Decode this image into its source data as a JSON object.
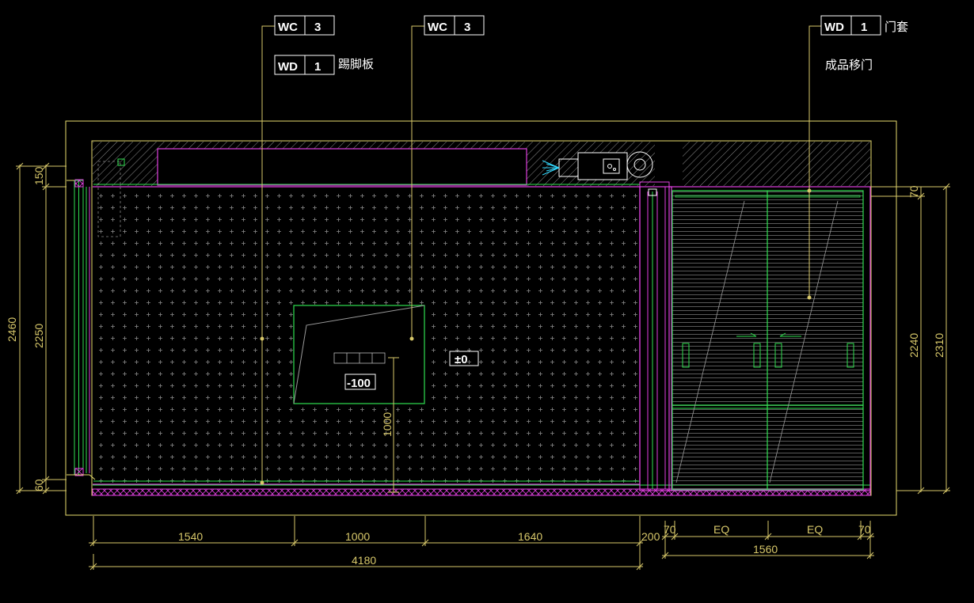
{
  "drawing": {
    "colors": {
      "background": "#000000",
      "outline": "#e8dc6e",
      "dimension": "#d8c86a",
      "magenta": "#e040e0",
      "green": "#30e050",
      "grey": "#9a9a9a",
      "cyan": "#30d8ff",
      "white": "#ffffff"
    },
    "tags": [
      {
        "code": "WC",
        "num": "3",
        "note": ""
      },
      {
        "code": "WD",
        "num": "1",
        "note": "踢脚板"
      },
      {
        "code": "WC",
        "num": "3",
        "note": ""
      },
      {
        "code": "WD",
        "num": "1",
        "note": "门套"
      }
    ],
    "notes": {
      "door": "成品移门"
    },
    "levels": {
      "floor": "±0",
      "recess": "-100"
    },
    "bottom_dims": {
      "row1": [
        "1540",
        "1000",
        "1640",
        "200",
        "70",
        "EQ",
        "EQ",
        "70"
      ],
      "row2": [
        "4180",
        "1560"
      ]
    },
    "left_dims": [
      "2460",
      "2250",
      "150",
      "60"
    ],
    "right_dims": [
      "2240",
      "2310",
      "70"
    ],
    "inner_dim": "1000"
  }
}
